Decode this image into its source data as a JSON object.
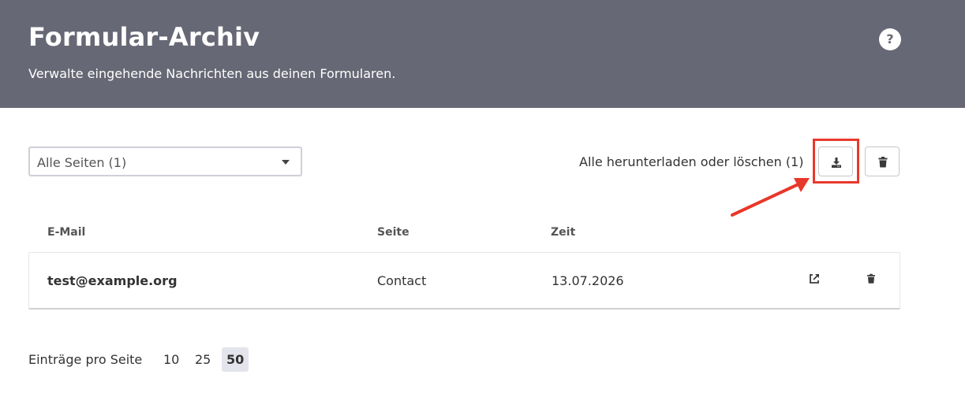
{
  "header": {
    "title": "Formular-Archiv",
    "subtitle": "Verwalte eingehende Nachrichten aus deinen Formularen.",
    "help_label": "?"
  },
  "filter": {
    "selected": "Alle Seiten (1)"
  },
  "bulk": {
    "label": "Alle herunterladen oder löschen (1)",
    "download_icon": "download-icon",
    "delete_icon": "trash-icon"
  },
  "table": {
    "columns": [
      "E-Mail",
      "Seite",
      "Zeit"
    ],
    "rows": [
      {
        "email": "test@example.org",
        "page": "Contact",
        "time": "13.07.2026"
      }
    ]
  },
  "pagination": {
    "label": "Einträge pro Seite",
    "options": [
      "10",
      "25",
      "50"
    ],
    "selected": "50"
  },
  "colors": {
    "header_bg": "#676875",
    "highlight": "#e8382b",
    "active_page_bg": "#e4e4ec"
  }
}
